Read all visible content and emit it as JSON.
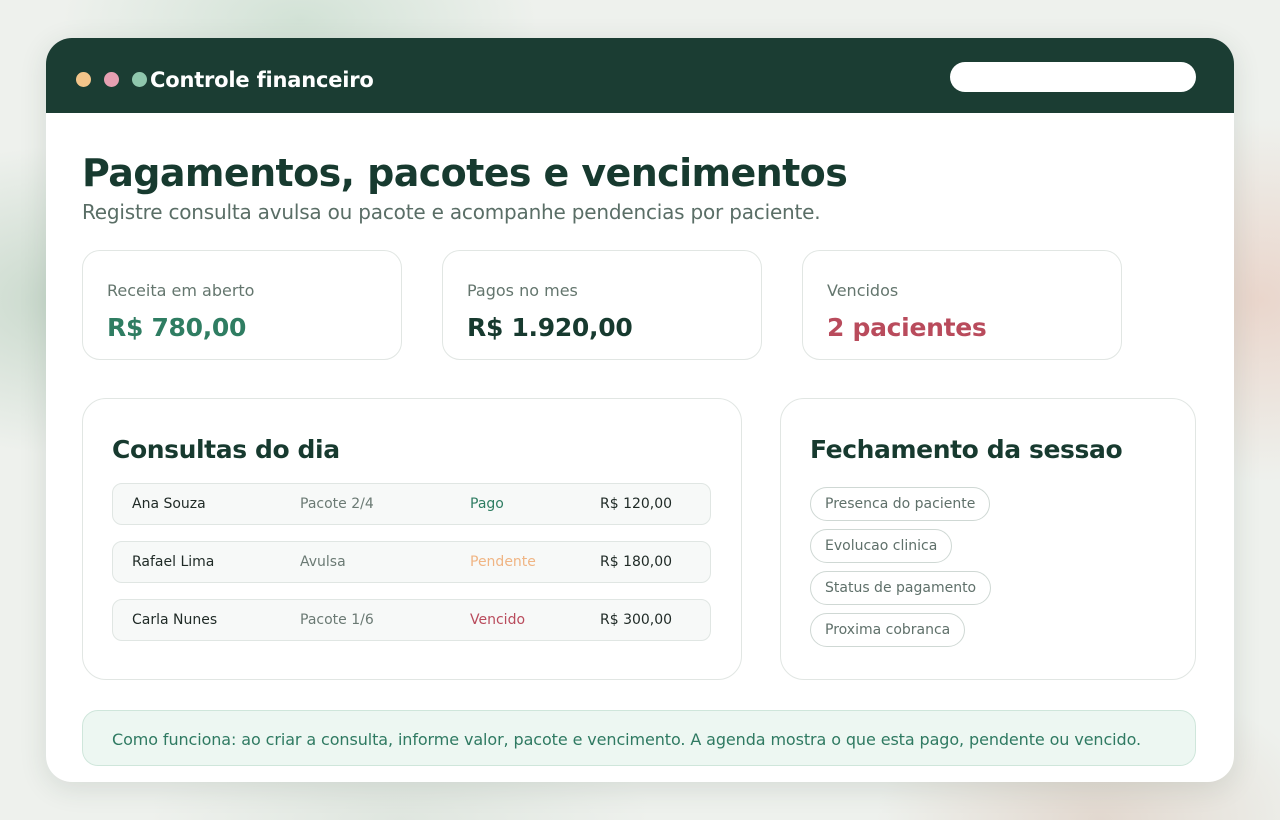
{
  "colors": {
    "titlebar": "#1b3d33",
    "dot_yellow": "#f3c58a",
    "dot_pink": "#e6a0b2",
    "dot_green": "#8fc7ad",
    "positive": "#2f7d62",
    "dark": "#173a2f",
    "danger": "#b94b5c",
    "pending": "#f0b584",
    "paid": "#2f7d62"
  },
  "window": {
    "title": "Controle financeiro",
    "search_placeholder": ""
  },
  "header": {
    "title": "Pagamentos, pacotes e vencimentos",
    "subtitle": "Registre consulta avulsa ou pacote e acompanhe pendencias por paciente."
  },
  "stats": [
    {
      "label": "Receita em aberto",
      "value": "R$ 780,00"
    },
    {
      "label": "Pagos no mes",
      "value": "R$ 1.920,00"
    },
    {
      "label": "Vencidos",
      "value": "2 pacientes"
    }
  ],
  "consultas": {
    "title": "Consultas do dia",
    "rows": [
      {
        "name": "Ana Souza",
        "type": "Pacote 2/4",
        "status": "Pago",
        "value": "R$ 120,00"
      },
      {
        "name": "Rafael Lima",
        "type": "Avulsa",
        "status": "Pendente",
        "value": "R$ 180,00"
      },
      {
        "name": "Carla Nunes",
        "type": "Pacote 1/6",
        "status": "Vencido",
        "value": "R$ 300,00"
      }
    ]
  },
  "fechamento": {
    "title": "Fechamento da sessao",
    "items": [
      "Presenca do paciente",
      "Evolucao clinica",
      "Status de pagamento",
      "Proxima cobranca"
    ]
  },
  "info": {
    "text": "Como funciona: ao criar a consulta, informe valor, pacote e vencimento. A agenda mostra o que esta pago, pendente ou vencido."
  }
}
